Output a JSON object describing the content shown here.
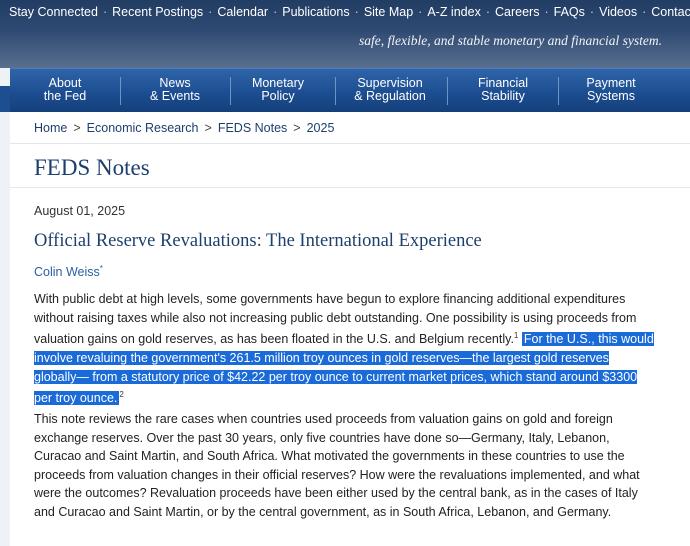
{
  "top_nav": {
    "items": [
      "Stay Connected",
      "Recent Postings",
      "Calendar",
      "Publications",
      "Site Map",
      "A-Z index",
      "Careers",
      "FAQs",
      "Videos",
      "Contact"
    ],
    "separator": "·",
    "tagline": "safe, flexible, and stable monetary and financial system."
  },
  "main_nav": {
    "items": [
      {
        "line1": "About",
        "line2": "the Fed"
      },
      {
        "line1": "News",
        "line2": "& Events"
      },
      {
        "line1": "Monetary",
        "line2": "Policy"
      },
      {
        "line1": "Supervision",
        "line2": "& Regulation"
      },
      {
        "line1": "Financial",
        "line2": "Stability"
      },
      {
        "line1": "Payment",
        "line2": "Systems"
      }
    ]
  },
  "breadcrumb": {
    "items": [
      "Home",
      "Economic Research",
      "FEDS Notes",
      "2025"
    ],
    "separator": ">"
  },
  "page": {
    "title": "FEDS Notes"
  },
  "article": {
    "date": "August 01, 2025",
    "title": "Official Reserve Revaluations: The International Experience",
    "author": "Colin Weiss",
    "author_mark": "*",
    "p1_before": "With public debt at high levels, some governments have begun to explore financing additional expenditures without raising taxes while also not increasing public debt outstanding. One possibility is using proceeds from valuation gains on gold reserves, as has been floated in the U.S. and Belgium recently.",
    "p1_fn1": "1",
    "p1_highlight": "For the U.S., this would involve revaluing the government's 261.5 million troy ounces in gold reserves—the largest gold reserves globally— from a statutory price of $42.22 per troy ounce to current market prices, which stand around $3300 per troy ounce.",
    "p1_fn2": "2",
    "p2": "This note reviews the rare cases when countries used proceeds from valuation gains on gold and foreign exchange reserves. Over the past 30 years, only five countries have done so—Germany, Italy, Lebanon, Curacao and Saint Martin, and South Africa. What motivated the governments in these countries to use the proceeds from valuation changes in their official reserves? How were the revaluations implemented, and what were the outcomes? Revaluation proceeds have been either used by the central bank, as in the cases of Italy and Curacao and Saint Martin, or by the central government, as in South Africa, Lebanon, and Germany."
  },
  "colors": {
    "header_dark": "#223d64",
    "nav_blue": "#1d4e92",
    "title_blue": "#1d3f6e",
    "link_blue": "#2a5ea6",
    "highlight": "#1a6bd8"
  }
}
